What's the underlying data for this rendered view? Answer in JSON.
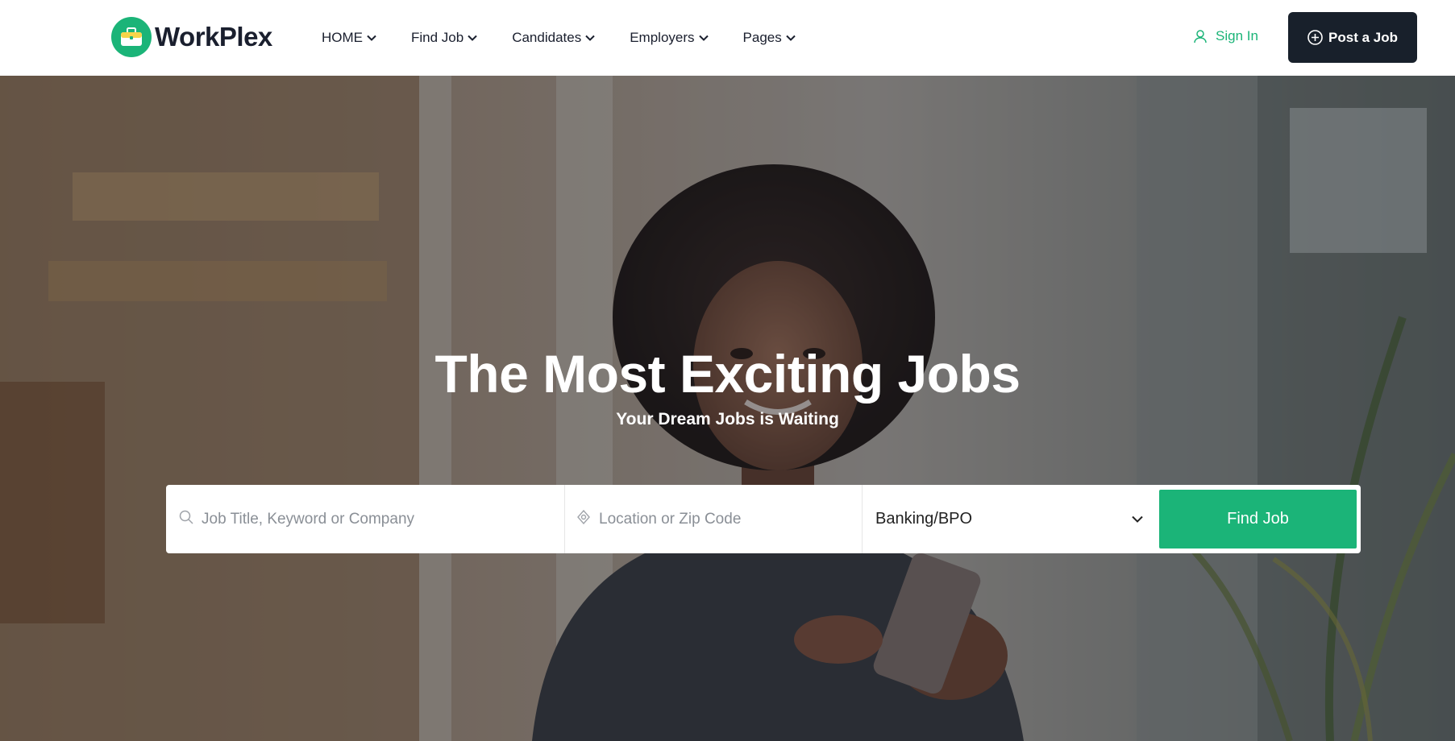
{
  "brand": {
    "name": "WorkPlex",
    "accent": "#1bb478",
    "dark": "#18202b"
  },
  "nav": {
    "items": [
      {
        "label": "HOME"
      },
      {
        "label": "Find Job"
      },
      {
        "label": "Candidates"
      },
      {
        "label": "Employers"
      },
      {
        "label": "Pages"
      }
    ]
  },
  "header": {
    "sign_in_label": "Sign In",
    "post_job_label": "Post a Job"
  },
  "hero": {
    "title": "The Most Exciting Jobs",
    "subtitle": "Your Dream Jobs is Waiting"
  },
  "search": {
    "keyword_placeholder": "Job Title, Keyword or Company",
    "location_placeholder": "Location or Zip Code",
    "category_selected": "Banking/BPO",
    "submit_label": "Find Job"
  }
}
